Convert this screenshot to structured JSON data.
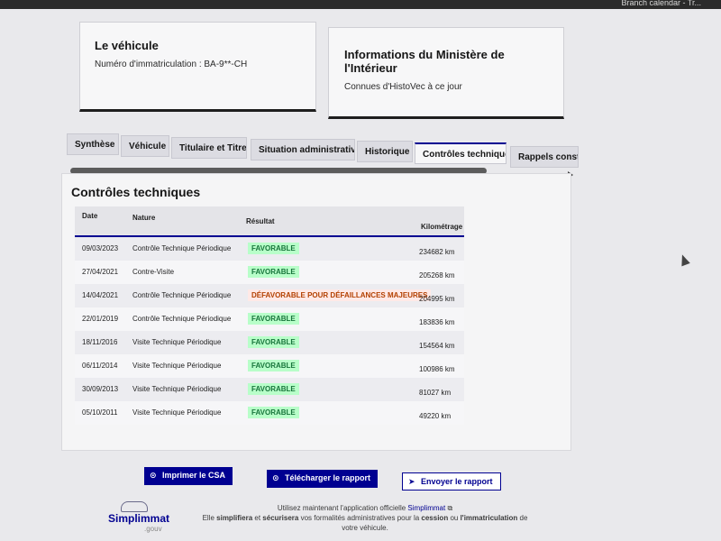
{
  "browser": {
    "tab_text": "Branch calendar - Tr..."
  },
  "vehicle_card": {
    "title": "Le véhicule",
    "plate_label": "Numéro d'immatriculation : BA-9**-CH"
  },
  "ministry_card": {
    "title": "Informations du Ministère de l'Intérieur",
    "subtitle": "Connues d'HistoVec à ce jour"
  },
  "tabs": [
    {
      "label": "Synthèse"
    },
    {
      "label": "Véhicule"
    },
    {
      "label": "Titulaire et Titre"
    },
    {
      "label": "Situation administrative"
    },
    {
      "label": "Historique"
    },
    {
      "label": "Contrôles techniques"
    },
    {
      "label": "Rappels constructeur"
    }
  ],
  "active_tab": "Contrôles techniques",
  "section": {
    "title": "Contrôles techniques",
    "columns": {
      "date": "Date",
      "nature": "Nature",
      "result": "Résultat",
      "km": "Kilométrage"
    },
    "rows": [
      {
        "date": "09/03/2023",
        "nature": "Contrôle Technique Périodique",
        "result": "FAVORABLE",
        "status": "ok",
        "km": "234682 km"
      },
      {
        "date": "27/04/2021",
        "nature": "Contre-Visite",
        "result": "FAVORABLE",
        "status": "ok",
        "km": "205268 km"
      },
      {
        "date": "14/04/2021",
        "nature": "Contrôle Technique Périodique",
        "result": "DÉFAVORABLE POUR DÉFAILLANCES MAJEURES",
        "status": "ko",
        "km": "204995 km"
      },
      {
        "date": "22/01/2019",
        "nature": "Contrôle Technique Périodique",
        "result": "FAVORABLE",
        "status": "ok",
        "km": "183836 km"
      },
      {
        "date": "18/11/2016",
        "nature": "Visite Technique Périodique",
        "result": "FAVORABLE",
        "status": "ok",
        "km": "154564 km"
      },
      {
        "date": "06/11/2014",
        "nature": "Visite Technique Périodique",
        "result": "FAVORABLE",
        "status": "ok",
        "km": "100986 km"
      },
      {
        "date": "30/09/2013",
        "nature": "Visite Technique Périodique",
        "result": "FAVORABLE",
        "status": "ok",
        "km": "81027 km"
      },
      {
        "date": "05/10/2011",
        "nature": "Visite Technique Périodique",
        "result": "FAVORABLE",
        "status": "ok",
        "km": "49220 km"
      }
    ]
  },
  "actions": {
    "print_label": "Imprimer le CSA",
    "download_label": "Télécharger le rapport",
    "send_label": "Envoyer le rapport"
  },
  "footer": {
    "line1_prefix": "Utilisez maintenant l'application officielle",
    "app_link": "Simplimmat",
    "line2_a": "Elle",
    "line2_b": "simplifiera",
    "line2_c": "et",
    "line2_d": "sécurisera",
    "line2_e": "vos formalités administratives pour la",
    "line2_f": "cession",
    "line2_g": "ou",
    "line2_h": "l'immatriculation",
    "line2_i": "de",
    "line3": "votre véhicule.",
    "logo_text": "Simplimmat",
    "logo_sub": ".gouv"
  },
  "colors": {
    "primary": "#000091",
    "success_bg": "#b8fec9",
    "success_text": "#18753c",
    "error_bg": "#ffe9e6",
    "error_text": "#b34000"
  }
}
